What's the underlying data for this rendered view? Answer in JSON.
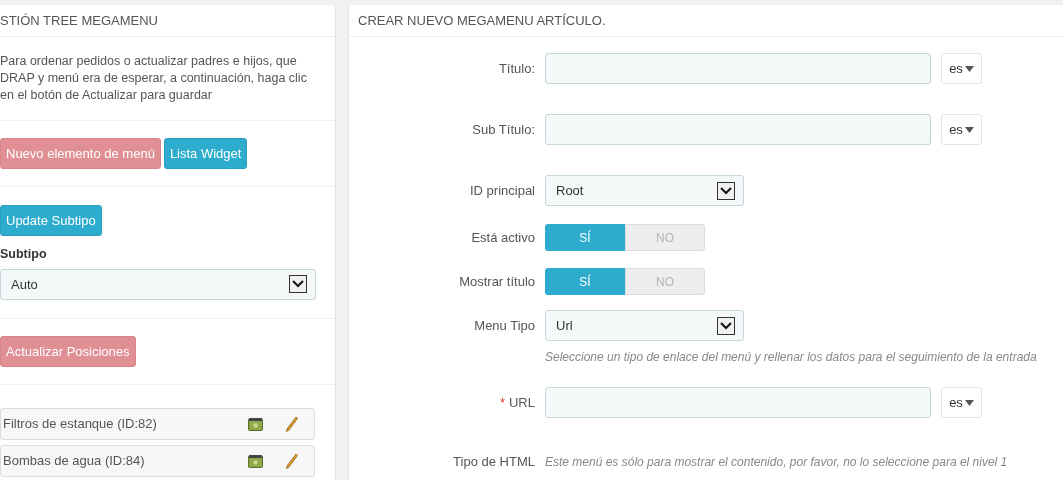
{
  "left_panel": {
    "title": "STIÓN TREE MEGAMENU",
    "description": "Para ordenar pedidos o actualizar padres e hijos, que DRAP y menú era de esperar, a continuación, haga clic en el botón de Actualizar para guardar",
    "buttons": [
      {
        "label": "Nuevo elemento de menú",
        "kind": "danger"
      },
      {
        "label": "Lista Widget",
        "kind": "info"
      }
    ],
    "update_button": {
      "label": "Update Subtipo",
      "kind": "info"
    },
    "subtype": {
      "label": "Subtipo",
      "value": "Auto"
    },
    "positions_button": {
      "label": "Actualizar Posiciones",
      "kind": "danger"
    },
    "tree_items": [
      {
        "label": "Filtros de estanque (ID:82)"
      },
      {
        "label": "Bombas de agua (ID:84)"
      }
    ]
  },
  "right_panel": {
    "title": "CREAR NUEVO MEGAMENU ARTÍCULO.",
    "fields": [
      {
        "kind": "text",
        "label": "Título:",
        "lang": "es"
      },
      {
        "kind": "text",
        "label": "Sub Título:",
        "lang": "es"
      },
      {
        "kind": "select",
        "label": "ID principal",
        "value": "Root"
      },
      {
        "kind": "switch",
        "label": "Está activo",
        "options": [
          {
            "label": "SÍ",
            "selected": true
          },
          {
            "label": "NO",
            "selected": false
          }
        ]
      },
      {
        "kind": "switch",
        "label": "Mostrar título",
        "options": [
          {
            "label": "SÍ",
            "selected": true
          },
          {
            "label": "NO",
            "selected": false
          }
        ]
      },
      {
        "kind": "select",
        "label": "Menu Tipo",
        "value": "Url",
        "help": "Seleccione un tipo de enlace del menú y rellenar los datos para el seguimiento de la entrada"
      },
      {
        "kind": "text",
        "label": "URL",
        "required_mark": "*",
        "lang": "es"
      },
      {
        "kind": "note",
        "label": "Tipo de HTML",
        "help": "Este menú es sólo para mostrar el contenido, por favor, no lo seleccione para el nivel 1"
      }
    ]
  }
}
